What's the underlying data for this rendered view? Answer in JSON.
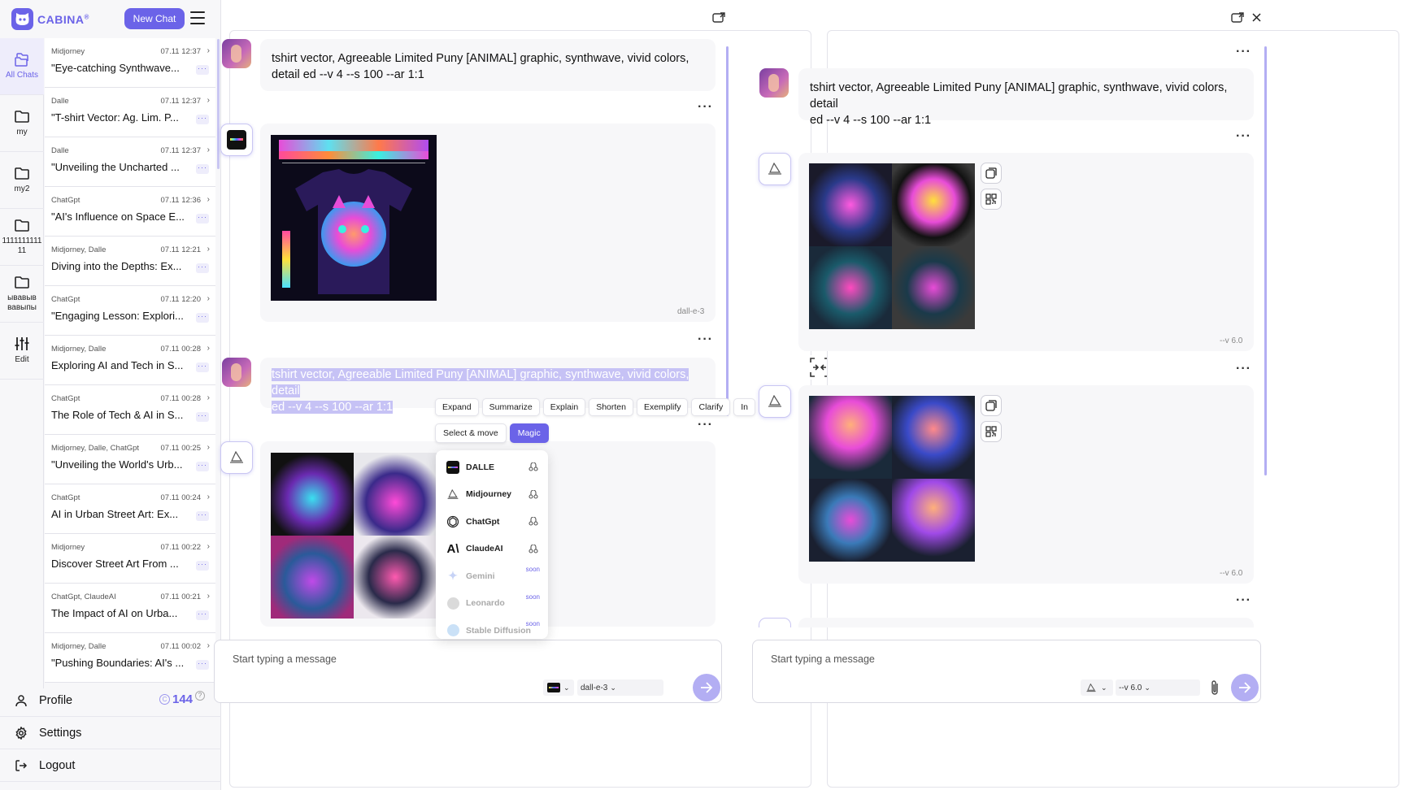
{
  "app": {
    "brand": "CABINA",
    "brand_mark": "®",
    "new_chat": "New Chat"
  },
  "folders": [
    {
      "label": "All Chats",
      "icon": "folder-stack-icon",
      "active": true
    },
    {
      "label": "my",
      "icon": "folder-icon"
    },
    {
      "label": "my2",
      "icon": "folder-icon"
    },
    {
      "label": "1111111111 11",
      "icon": "folder-icon"
    },
    {
      "label": "ывавыв вавыпы",
      "icon": "folder-icon"
    },
    {
      "label": "Edit",
      "icon": "sliders-icon"
    }
  ],
  "chats": [
    {
      "models": "Midjorney",
      "time": "07.11 12:37",
      "title": "\"Eye-catching Synthwave..."
    },
    {
      "models": "Dalle",
      "time": "07.11 12:37",
      "title": "\"T-shirt Vector: Ag. Lim. P..."
    },
    {
      "models": "Dalle",
      "time": "07.11 12:37",
      "title": "\"Unveiling the Uncharted ..."
    },
    {
      "models": "ChatGpt",
      "time": "07.11 12:36",
      "title": "\"AI's Influence on Space E..."
    },
    {
      "models": "Midjorney, Dalle",
      "time": "07.11 12:21",
      "title": "Diving into the Depths: Ex..."
    },
    {
      "models": "ChatGpt",
      "time": "07.11 12:20",
      "title": "\"Engaging Lesson: Explori..."
    },
    {
      "models": "Midjorney, Dalle",
      "time": "07.11 00:28",
      "title": "Exploring AI and Tech in S..."
    },
    {
      "models": "ChatGpt",
      "time": "07.11 00:28",
      "title": "The Role of Tech & AI in S..."
    },
    {
      "models": "Midjorney, Dalle, ChatGpt",
      "time": "07.11 00:25",
      "title": "\"Unveiling the World's Urb..."
    },
    {
      "models": "ChatGpt",
      "time": "07.11 00:24",
      "title": "AI in Urban Street Art: Ex..."
    },
    {
      "models": "Midjorney",
      "time": "07.11 00:22",
      "title": "Discover Street Art From ..."
    },
    {
      "models": "ChatGpt, ClaudeAI",
      "time": "07.11 00:21",
      "title": "The Impact of AI on Urba..."
    },
    {
      "models": "Midjorney, Dalle",
      "time": "07.11 00:02",
      "title": "\"Pushing Boundaries: AI's ..."
    }
  ],
  "bottom": {
    "profile": "Profile",
    "credits": "144",
    "settings": "Settings",
    "logout": "Logout"
  },
  "left_panel": {
    "prompt1": "tshirt vector, Agreeable Limited Puny [ANIMAL] graphic, synthwave, vivid colors, detail ed --v 4 --s 100 --ar 1:1",
    "tag1": "dall-e-3",
    "prompt2_line1": "tshirt vector, Agreeable Limited Puny [ANIMAL] graphic, synthwave, vivid colors, detail",
    "prompt2_line2": "ed --v 4 --s 100 --ar 1:1",
    "placeholder": "Start typing a message",
    "model_version": "dall-e-3"
  },
  "right_panel": {
    "prompt1_line1": "tshirt vector, Agreeable Limited Puny [ANIMAL] graphic, synthwave, vivid colors, detail",
    "prompt1_line2": "ed --v 4 --s 100 --ar 1:1",
    "tag1": "--v 6.0",
    "tag2": "--v 6.0",
    "placeholder": "Start typing a message",
    "model_version": "--v 6.0"
  },
  "selection_toolbar": [
    "Expand",
    "Summarize",
    "Explain",
    "Shorten",
    "Exemplify",
    "Clarify",
    "In"
  ],
  "selection_toolbar2": [
    "Select & move",
    "Magic"
  ],
  "model_menu": [
    {
      "name": "DALLE",
      "soon": ""
    },
    {
      "name": "Midjourney",
      "soon": ""
    },
    {
      "name": "ChatGpt",
      "soon": ""
    },
    {
      "name": "ClaudeAI",
      "soon": ""
    },
    {
      "name": "Gemini",
      "soon": "soon"
    },
    {
      "name": "Leonardo",
      "soon": "soon"
    },
    {
      "name": "Stable Diffusion",
      "soon": "soon"
    }
  ],
  "colors": {
    "accent": "#6b63e8",
    "accent_light": "#b3aef3",
    "panel_bg": "#f7f7f9"
  }
}
